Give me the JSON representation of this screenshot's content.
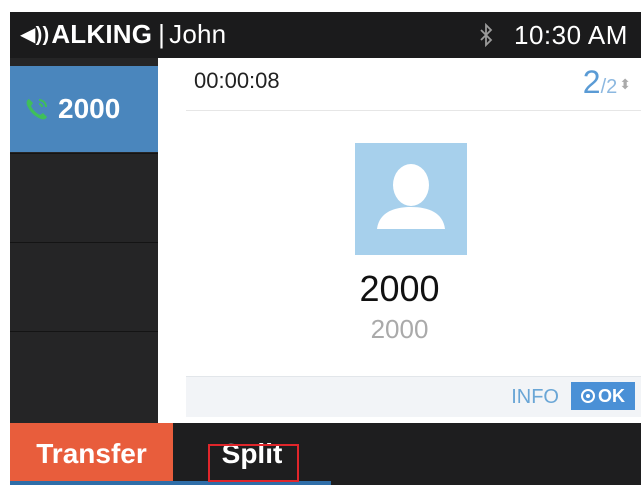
{
  "status": {
    "title": "ALKING",
    "user": "John",
    "time": "10:30 AM",
    "icons": [
      "speaker-icon",
      "bluetooth-icon"
    ]
  },
  "line": {
    "number": "2000",
    "icon": "phone-call-icon"
  },
  "call": {
    "duration": "00:00:08",
    "page_current": "2",
    "page_total": "/2",
    "contact_name": "2000",
    "contact_number": "2000",
    "info_label": "INFO",
    "ok_label": "OK"
  },
  "softkeys": {
    "transfer": "Transfer",
    "split": "Split"
  },
  "colors": {
    "accent_blue": "#4a86bd",
    "transfer_orange": "#e85d3c",
    "highlight_red": "#e0262b",
    "call_green": "#3fbf5a"
  }
}
